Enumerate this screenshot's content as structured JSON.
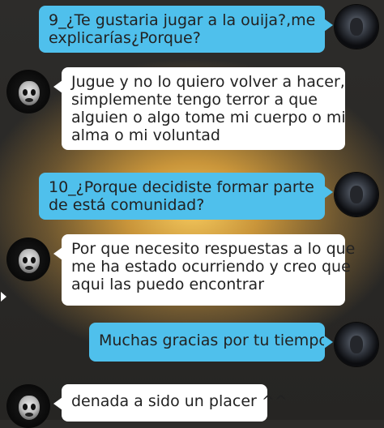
{
  "messages": [
    {
      "sender": "me",
      "lines": [
        "9_¿Te gustaria jugar a la ouija?,me",
        "explicarías¿Porque?"
      ]
    },
    {
      "sender": "them",
      "lines": [
        "Jugue y no lo quiero volver a hacer,",
        "simplemente tengo terror a que",
        "alguien o algo tome mi cuerpo o mi",
        "alma o mi voluntad"
      ]
    },
    {
      "sender": "me",
      "lines": [
        "10_¿Porque decidiste formar parte",
        "de está comunidad?"
      ]
    },
    {
      "sender": "them",
      "lines": [
        "Por que necesito respuestas a lo que",
        "me ha estado ocurriendo y creo que",
        "aqui las puedo encontrar"
      ]
    },
    {
      "sender": "me",
      "lines": [
        "Muchas gracias por tu tiempo"
      ]
    },
    {
      "sender": "them",
      "lines": [
        "denada a sido un placer ^^"
      ]
    }
  ],
  "colors": {
    "my_bubble": "#4fc0ec",
    "their_bubble": "#ffffff",
    "background": "#2d2c2a",
    "glow": "#f5c95d"
  },
  "icons": {
    "my_avatar": "hooded-figure-avatar",
    "their_avatar": "masked-face-avatar",
    "scroll_hint": "chevron-right-icon"
  }
}
